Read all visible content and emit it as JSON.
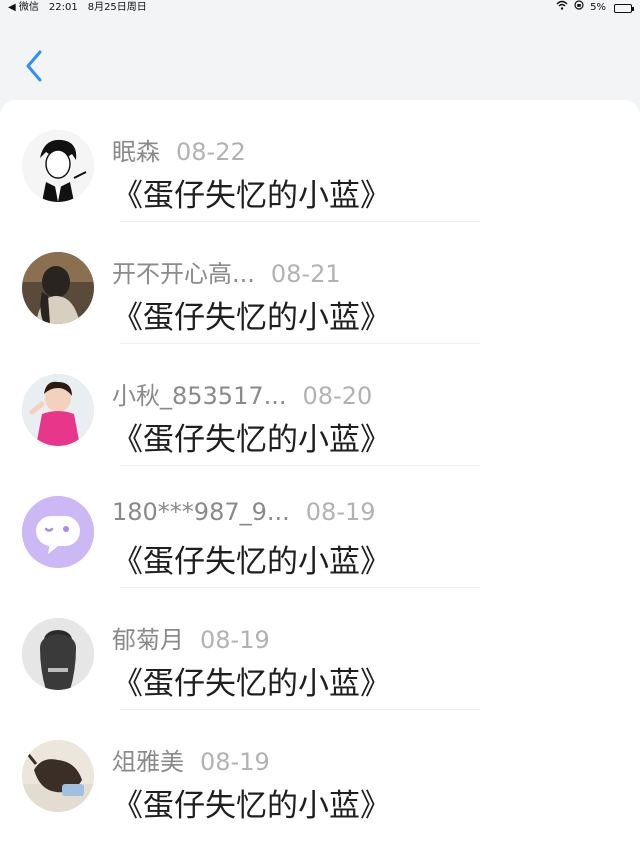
{
  "status": {
    "app": "◀ 微信",
    "time": "22:01",
    "date": "8月25日周日",
    "battery": "5%"
  },
  "items": [
    {
      "name": "眠森",
      "date": "08-22",
      "title": "《蛋仔失忆的小蓝》",
      "avatar": "manga-man"
    },
    {
      "name": "开不开心高...",
      "date": "08-21",
      "title": "《蛋仔失忆的小蓝》",
      "avatar": "girl-dark"
    },
    {
      "name": "小秋_853517...",
      "date": "08-20",
      "title": "《蛋仔失忆的小蓝》",
      "avatar": "girl-pink"
    },
    {
      "name": "180***987_9...",
      "date": "08-19",
      "title": "《蛋仔失忆的小蓝》",
      "avatar": "chat-bubble"
    },
    {
      "name": "郁菊月",
      "date": "08-19",
      "title": "《蛋仔失忆的小蓝》",
      "avatar": "woman-gray"
    },
    {
      "name": "俎雅美",
      "date": "08-19",
      "title": "《蛋仔失忆的小蓝》",
      "avatar": "cow-photo"
    }
  ],
  "colors": {
    "accent": "#2f8ef7",
    "panel": "#ffffff",
    "background": "#f3f4f6"
  }
}
